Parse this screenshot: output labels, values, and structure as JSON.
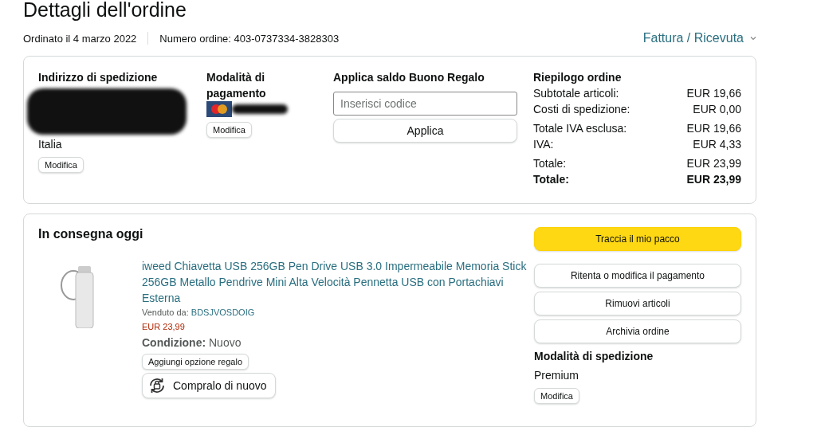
{
  "page_title": "Dettagli dell'ordine",
  "order_date": "Ordinato il 4 marzo 2022",
  "order_number": "Numero ordine: 403-0737334-3828303",
  "invoice_link": "Fattura / Ricevuta",
  "shipping_address": {
    "heading": "Indirizzo di spedizione",
    "country": "Italia",
    "button": "Modifica"
  },
  "payment": {
    "heading": "Modalità di pagamento",
    "button": "Modifica"
  },
  "gift_card": {
    "heading": "Applica saldo Buono Regalo",
    "placeholder": "Inserisci codice",
    "button": "Applica"
  },
  "summary": {
    "heading": "Riepilogo ordine",
    "rows": [
      {
        "label": "Subtotale articoli:",
        "value": "EUR 19,66",
        "bold": false
      },
      {
        "label": "Costi di spedizione:",
        "value": "EUR 0,00",
        "bold": false
      },
      {
        "label": "Totale IVA esclusa:",
        "value": "EUR 19,66",
        "bold": false
      },
      {
        "label": "IVA:",
        "value": "EUR 4,33",
        "bold": false
      },
      {
        "label": "Totale:",
        "value": "EUR 23,99",
        "bold": false
      },
      {
        "label": "Totale:",
        "value": "EUR 23,99",
        "bold": true
      }
    ]
  },
  "shipment": {
    "status": "In consegna oggi",
    "item": {
      "title": "iweed Chiavetta USB 256GB Pen Drive USB 3.0 Impermeabile Memoria Stick 256GB Metallo Pendrive Mini Alta Velocità Pennetta USB con Portachiavi Esterna",
      "sold_by_label": "Venduto da:",
      "seller": "BDSJVOSDOIG",
      "price": "EUR 23,99",
      "condition_label": "Condizione:",
      "condition": "Nuovo",
      "gift_button": "Aggiungi opzione regalo",
      "buy_again_button": "Compralo di nuovo"
    },
    "actions": [
      {
        "label": "Traccia il mio pacco",
        "kind": "primary"
      },
      {
        "label": "Ritenta o modifica il pagamento",
        "kind": "secondary"
      },
      {
        "label": "Rimuovi articoli",
        "kind": "secondary"
      },
      {
        "label": "Archivia ordine",
        "kind": "secondary"
      }
    ],
    "shipping_method": {
      "heading": "Modalità di spedizione",
      "value": "Premium",
      "button": "Modifica"
    }
  }
}
